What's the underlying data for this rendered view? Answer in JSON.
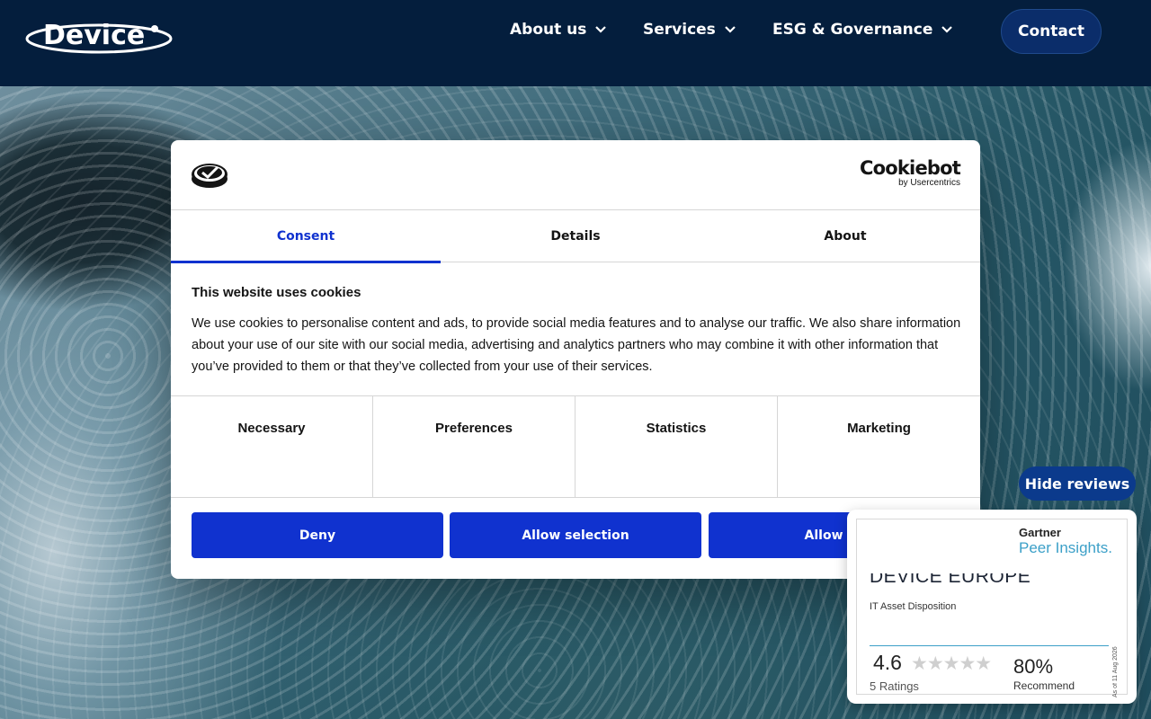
{
  "header": {
    "logo_text": "Device",
    "nav": [
      {
        "label": "About us"
      },
      {
        "label": "Services"
      },
      {
        "label": "ESG & Governance"
      }
    ],
    "contact_label": "Contact"
  },
  "cookie_dialog": {
    "brand": "Cookiebot",
    "brand_sub": "by Usercentrics",
    "tabs": [
      {
        "label": "Consent",
        "active": true
      },
      {
        "label": "Details",
        "active": false
      },
      {
        "label": "About",
        "active": false
      }
    ],
    "title": "This website uses cookies",
    "body": "We use cookies to personalise content and ads, to provide social media features and to analyse our traffic. We also share information about your use of our site with our social media, advertising and analytics partners who may combine it with other information that you’ve provided to them or that they’ve collected from your use of their services.",
    "categories": [
      "Necessary",
      "Preferences",
      "Statistics",
      "Marketing"
    ],
    "buttons": {
      "deny": "Deny",
      "allow_selection": "Allow selection",
      "allow_all": "Allow all"
    },
    "accent_color": "#1032cf"
  },
  "reviews": {
    "hide_label": "Hide reviews",
    "gartner": "Gartner",
    "peer_insights": "Peer Insights.",
    "vendor": "DEVICE EUROPE",
    "category": "IT Asset Disposition",
    "score": "4.6",
    "stars": "★★★★★",
    "ratings": "5 Ratings",
    "recommend_pct": "80%",
    "recommend_label": "Recommend",
    "as_of": "As of 11 Aug 2026"
  },
  "colors": {
    "header_bg": "#041e3d",
    "contact_bg": "#0b2d6a",
    "reviews_btn_bg": "#0b3a8c"
  }
}
